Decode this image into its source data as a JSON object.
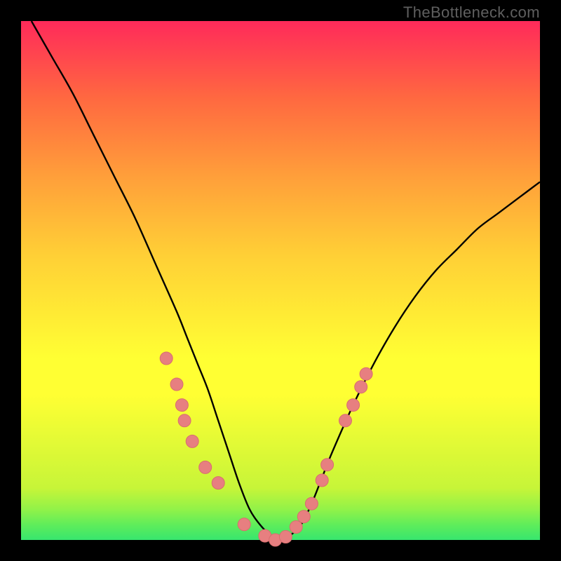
{
  "watermark": "TheBottleneck.com",
  "colors": {
    "background": "#000000",
    "curve": "#000000",
    "dot_fill": "#e77f80",
    "dot_stroke": "#d86e6e"
  },
  "chart_data": {
    "type": "line",
    "title": "",
    "xlabel": "",
    "ylabel": "",
    "xlim": [
      0,
      100
    ],
    "ylim": [
      0,
      100
    ],
    "series": [
      {
        "name": "bottleneck-curve",
        "x": [
          2,
          6,
          10,
          14,
          18,
          22,
          26,
          30,
          32,
          34,
          36,
          38,
          40,
          42,
          44,
          46,
          48,
          50,
          52,
          54,
          56,
          58,
          60,
          64,
          68,
          72,
          76,
          80,
          84,
          88,
          92,
          96,
          100
        ],
        "values": [
          100,
          93,
          86,
          78,
          70,
          62,
          53,
          44,
          39,
          34,
          29,
          23,
          17,
          11,
          6,
          3,
          1,
          0,
          1,
          3,
          7,
          12,
          17,
          26,
          34,
          41,
          47,
          52,
          56,
          60,
          63,
          66,
          69
        ]
      }
    ],
    "points": [
      {
        "x": 28.0,
        "y": 35.0
      },
      {
        "x": 30.0,
        "y": 30.0
      },
      {
        "x": 31.0,
        "y": 26.0
      },
      {
        "x": 31.5,
        "y": 23.0
      },
      {
        "x": 33.0,
        "y": 19.0
      },
      {
        "x": 35.5,
        "y": 14.0
      },
      {
        "x": 38.0,
        "y": 11.0
      },
      {
        "x": 43.0,
        "y": 3.0
      },
      {
        "x": 47.0,
        "y": 0.8
      },
      {
        "x": 49.0,
        "y": 0.0
      },
      {
        "x": 51.0,
        "y": 0.6
      },
      {
        "x": 53.0,
        "y": 2.5
      },
      {
        "x": 54.5,
        "y": 4.5
      },
      {
        "x": 56.0,
        "y": 7.0
      },
      {
        "x": 58.0,
        "y": 11.5
      },
      {
        "x": 59.0,
        "y": 14.5
      },
      {
        "x": 62.5,
        "y": 23.0
      },
      {
        "x": 64.0,
        "y": 26.0
      },
      {
        "x": 65.5,
        "y": 29.5
      },
      {
        "x": 66.5,
        "y": 32.0
      }
    ]
  }
}
